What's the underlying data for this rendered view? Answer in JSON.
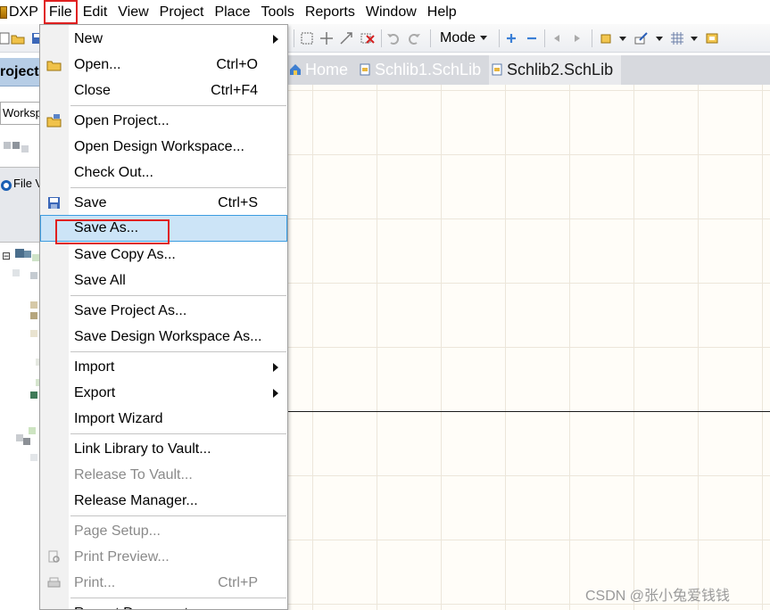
{
  "menubar": {
    "items": [
      "DXP",
      "File",
      "Edit",
      "View",
      "Project",
      "Place",
      "Tools",
      "Reports",
      "Window",
      "Help"
    ],
    "active": "File"
  },
  "toolbar": {
    "mode_label": "Mode"
  },
  "left_panel": {
    "title": "roject",
    "workspace_label": "Worksp",
    "file_view_label": "File V",
    "tree_toggle": "⊟"
  },
  "tabs": [
    {
      "label": "Home",
      "icon": "home-icon",
      "active": false
    },
    {
      "label": "Schlib1.SchLib",
      "icon": "schlib-file-icon",
      "active": false
    },
    {
      "label": "Schlib2.SchLib",
      "icon": "schlib-file-icon",
      "active": true
    }
  ],
  "file_menu": {
    "items": [
      {
        "label": "New",
        "shortcut": "",
        "submenu": true,
        "disabled": false,
        "icon": ""
      },
      {
        "label": "Open...",
        "shortcut": "Ctrl+O",
        "submenu": false,
        "disabled": false,
        "icon": "open-folder-icon"
      },
      {
        "label": "Close",
        "shortcut": "Ctrl+F4",
        "submenu": false,
        "disabled": false,
        "icon": ""
      },
      {
        "label": "Open Project...",
        "shortcut": "",
        "submenu": false,
        "disabled": false,
        "icon": "open-project-icon"
      },
      {
        "label": "Open Design Workspace...",
        "shortcut": "",
        "submenu": false,
        "disabled": false,
        "icon": ""
      },
      {
        "label": "Check Out...",
        "shortcut": "",
        "submenu": false,
        "disabled": false,
        "icon": ""
      },
      {
        "label": "Save",
        "shortcut": "Ctrl+S",
        "submenu": false,
        "disabled": false,
        "icon": "save-disk-icon"
      },
      {
        "label": "Save As...",
        "shortcut": "",
        "submenu": false,
        "disabled": false,
        "icon": "",
        "highlighted": true
      },
      {
        "label": "Save Copy As...",
        "shortcut": "",
        "submenu": false,
        "disabled": false,
        "icon": ""
      },
      {
        "label": "Save All",
        "shortcut": "",
        "submenu": false,
        "disabled": false,
        "icon": ""
      },
      {
        "label": "Save Project As...",
        "shortcut": "",
        "submenu": false,
        "disabled": false,
        "icon": ""
      },
      {
        "label": "Save Design Workspace As...",
        "shortcut": "",
        "submenu": false,
        "disabled": false,
        "icon": ""
      },
      {
        "label": "Import",
        "shortcut": "",
        "submenu": true,
        "disabled": false,
        "icon": ""
      },
      {
        "label": "Export",
        "shortcut": "",
        "submenu": true,
        "disabled": false,
        "icon": ""
      },
      {
        "label": "Import Wizard",
        "shortcut": "",
        "submenu": false,
        "disabled": false,
        "icon": ""
      },
      {
        "label": "Link Library to Vault...",
        "shortcut": "",
        "submenu": false,
        "disabled": false,
        "icon": ""
      },
      {
        "label": "Release To Vault...",
        "shortcut": "",
        "submenu": false,
        "disabled": true,
        "icon": ""
      },
      {
        "label": "Release Manager...",
        "shortcut": "",
        "submenu": false,
        "disabled": false,
        "icon": ""
      },
      {
        "label": "Page Setup...",
        "shortcut": "",
        "submenu": false,
        "disabled": true,
        "icon": ""
      },
      {
        "label": "Print Preview...",
        "shortcut": "",
        "submenu": false,
        "disabled": true,
        "icon": "print-preview-icon"
      },
      {
        "label": "Print...",
        "shortcut": "Ctrl+P",
        "submenu": false,
        "disabled": true,
        "icon": "printer-icon"
      },
      {
        "label": "Recent Documents",
        "shortcut": "",
        "submenu": true,
        "disabled": false,
        "icon": ""
      }
    ]
  },
  "watermark": "CSDN @张小兔爱钱钱",
  "colors": {
    "highlight_bg": "#cce4f7",
    "highlight_border": "#3c9ce0",
    "annotation_red": "#e02020",
    "panel_header": "#b6cde6"
  }
}
